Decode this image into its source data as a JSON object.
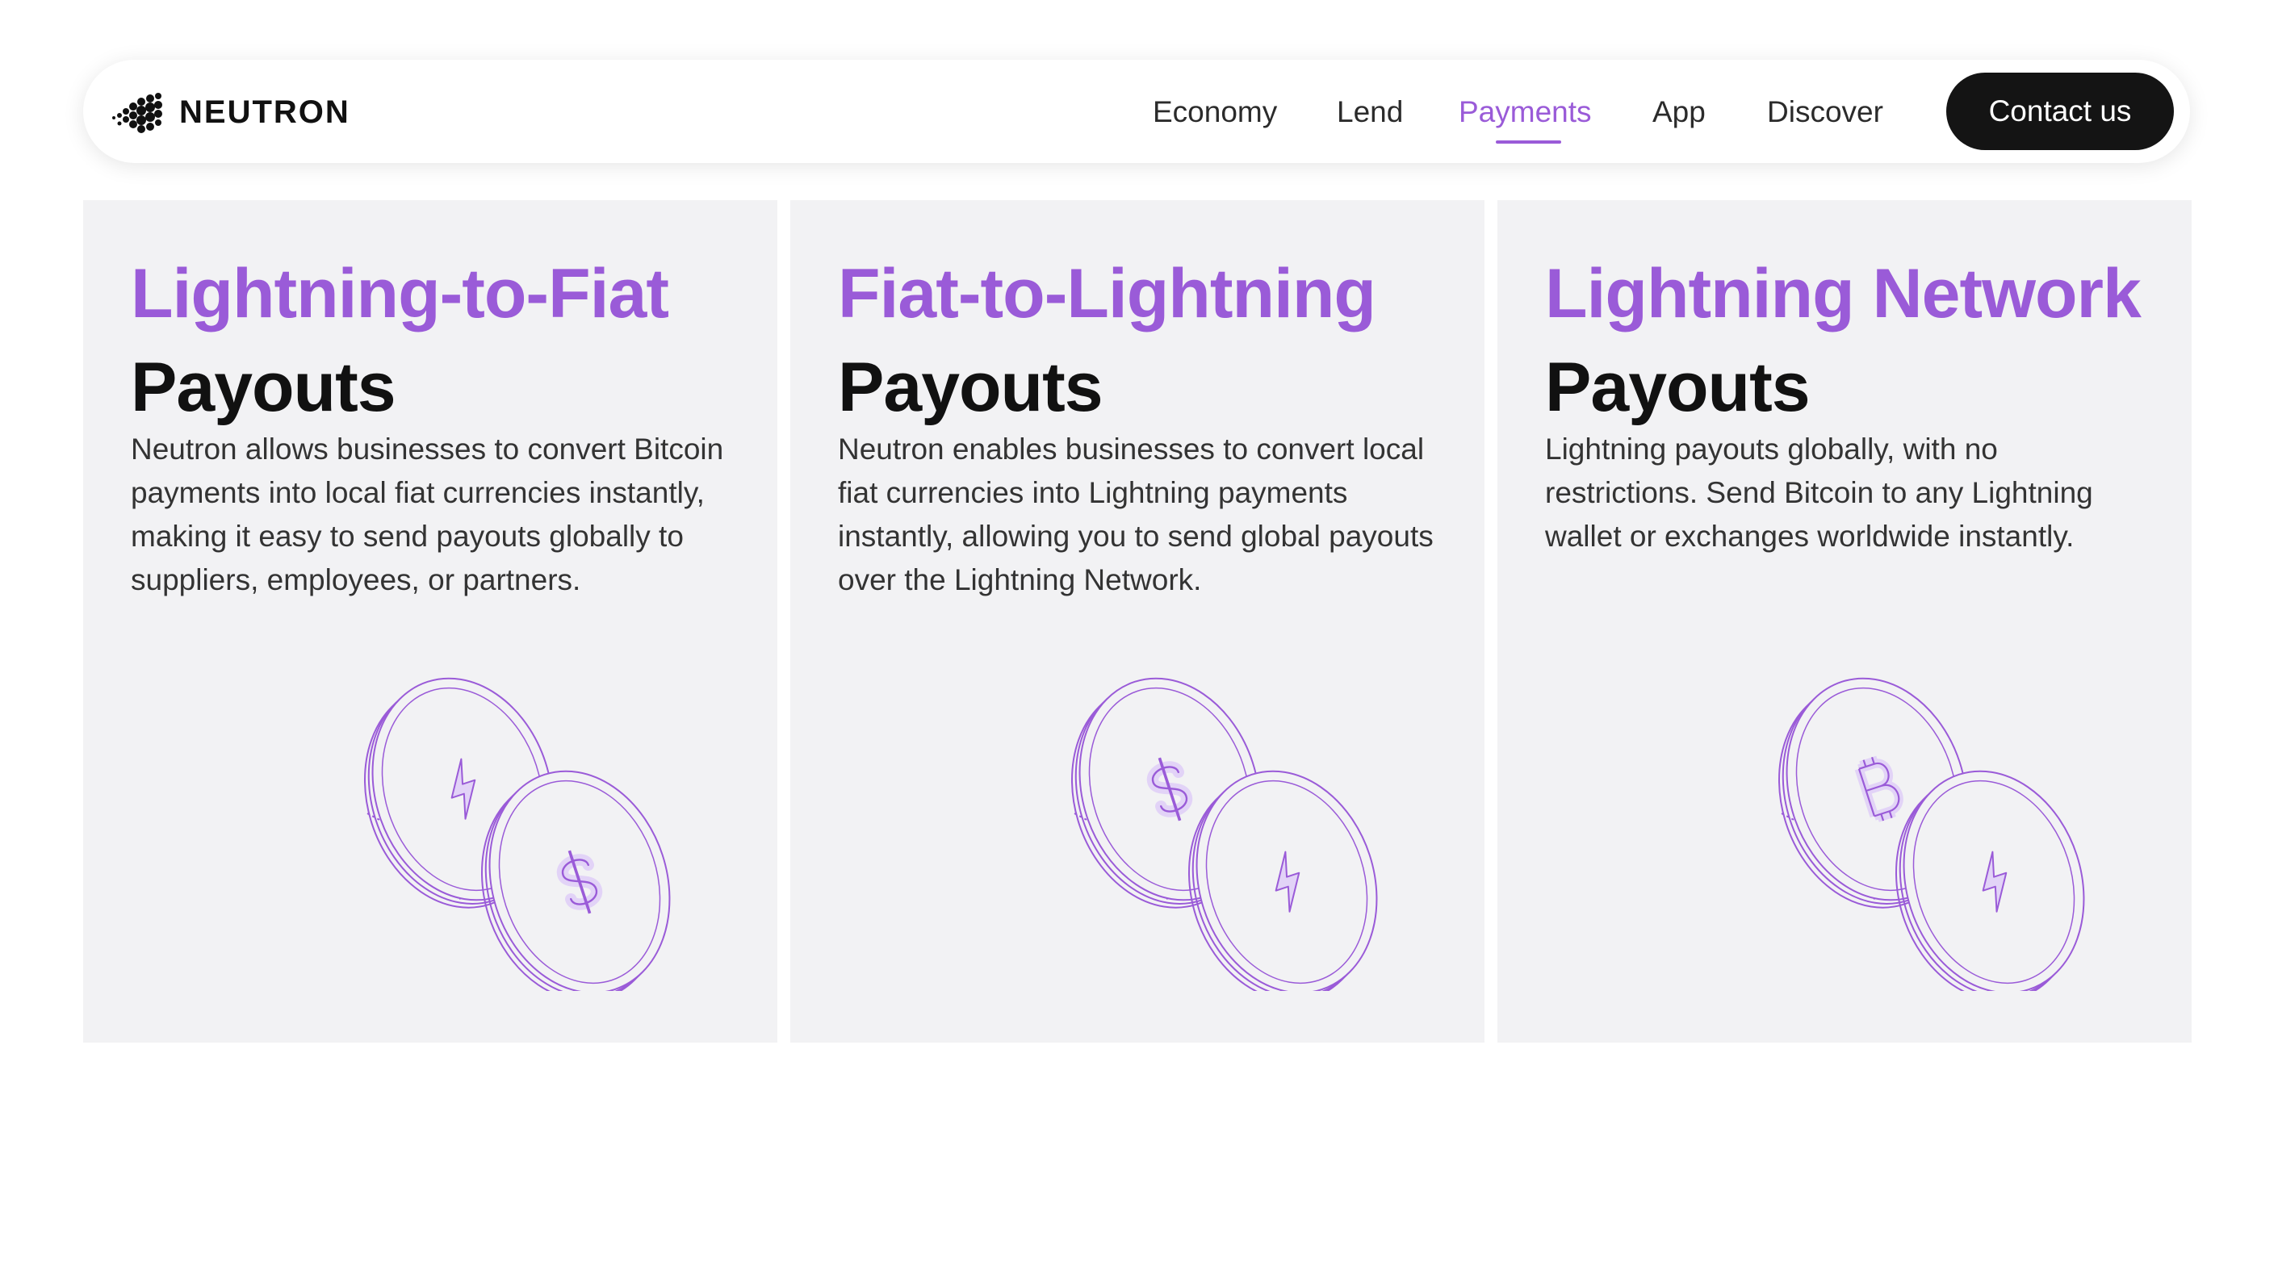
{
  "brand": {
    "name": "NEUTRON"
  },
  "nav": {
    "items": [
      {
        "label": "Economy"
      },
      {
        "label": "Lend"
      },
      {
        "label": "Payments"
      },
      {
        "label": "App"
      },
      {
        "label": "Discover"
      }
    ],
    "active": "Payments",
    "cta": "Contact us"
  },
  "colors": {
    "accent": "#9a5bd8",
    "card_bg": "#f2f2f4",
    "cta_bg": "#141414",
    "text": "#111111"
  },
  "cards": [
    {
      "title_accent": "Lightning-to-Fiat",
      "title_main": "Payouts",
      "description": "Neutron allows businesses to convert Bitcoin payments into local fiat currencies instantly, making it easy to send payouts globally to suppliers, employees, or partners.",
      "illustration": "lightning-to-dollar-coins-icon"
    },
    {
      "title_accent": "Fiat-to-Lightning",
      "title_main": "Payouts",
      "description": "Neutron enables businesses to convert local fiat currencies into Lightning payments instantly, allowing you to send global payouts over the Lightning Network.",
      "illustration": "dollar-to-lightning-coins-icon"
    },
    {
      "title_accent": "Lightning Network",
      "title_main": "Payouts",
      "description": "Lightning payouts globally, with no restrictions. Send Bitcoin to any Lightning wallet or exchanges worldwide instantly.",
      "illustration": "bitcoin-to-lightning-coins-icon"
    }
  ]
}
